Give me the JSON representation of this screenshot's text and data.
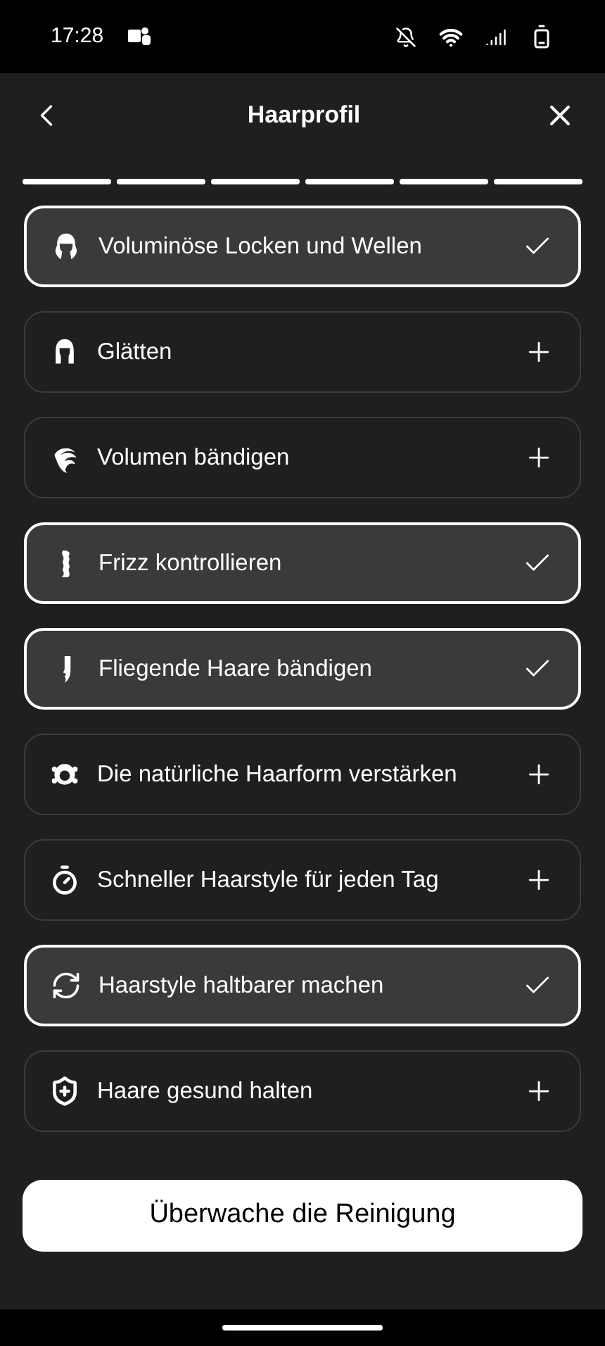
{
  "status_bar": {
    "time": "17:28"
  },
  "header": {
    "title": "Haarprofil"
  },
  "progress": [
    {
      "done": true
    },
    {
      "done": true
    },
    {
      "done": true
    },
    {
      "done": true
    },
    {
      "done": true
    },
    {
      "done": true
    }
  ],
  "options": [
    {
      "kind": "curls",
      "label": "Voluminöse Locken und Wellen",
      "selected": true
    },
    {
      "kind": "straight",
      "label": "Glätten",
      "selected": false
    },
    {
      "kind": "volume",
      "label": "Volumen bändigen",
      "selected": false
    },
    {
      "kind": "frizz",
      "label": "Frizz kontrollieren",
      "selected": true
    },
    {
      "kind": "flyaway",
      "label": "Fliegende Haare bändigen",
      "selected": true
    },
    {
      "kind": "natural",
      "label": "Die natürliche Haarform verstärken",
      "selected": false
    },
    {
      "kind": "timer",
      "label": "Schneller Haarstyle für jeden Tag",
      "selected": false
    },
    {
      "kind": "refresh",
      "label": "Haarstyle haltbarer machen",
      "selected": true
    },
    {
      "kind": "shield",
      "label": "Haare gesund halten",
      "selected": false
    }
  ],
  "primary_button": {
    "label": "Überwache die Reinigung"
  }
}
